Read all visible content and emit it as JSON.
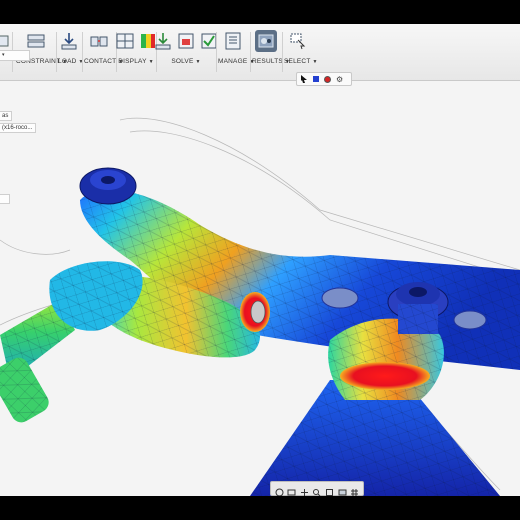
{
  "toolbar": {
    "groups": [
      {
        "id": "edit",
        "label": "",
        "icons": [
          "edit-icon"
        ]
      },
      {
        "id": "constraint",
        "label": "CONSTRAINT",
        "icons": [
          "constraint-icon"
        ]
      },
      {
        "id": "load",
        "label": "LOAD",
        "icons": [
          "load-icon"
        ]
      },
      {
        "id": "contact",
        "label": "CONTACT",
        "icons": [
          "contact-icon"
        ]
      },
      {
        "id": "display",
        "label": "DISPLAY",
        "icons": [
          "display-grid-icon",
          "display-palette-icon"
        ]
      },
      {
        "id": "solve",
        "label": "SOLVE",
        "icons": [
          "solve-icon",
          "precheck-icon",
          "check-icon"
        ]
      },
      {
        "id": "manage",
        "label": "MANAGE",
        "icons": [
          "manage-icon"
        ]
      },
      {
        "id": "results",
        "label": "RESULTS",
        "icons": [
          "results-icon"
        ]
      },
      {
        "id": "select",
        "label": "SELECT",
        "icons": [
          "select-icon"
        ]
      }
    ],
    "caret": "▼"
  },
  "browser": {
    "items": [
      "as",
      "(x16-roco..."
    ]
  },
  "colors": {
    "stress_max": "#e8162a",
    "stress_min": "#1535c8",
    "accent": "#5c6f86"
  }
}
